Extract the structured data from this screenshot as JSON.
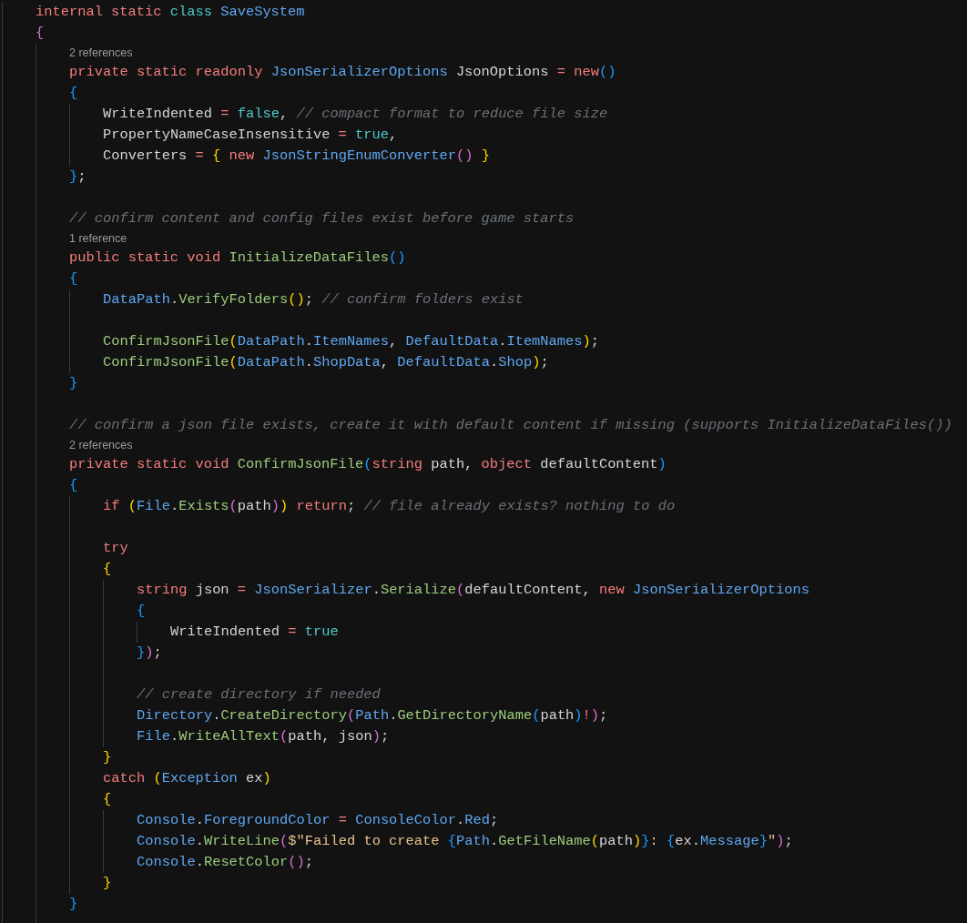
{
  "editor": {
    "lines": [
      {
        "kind": "code",
        "tokens": [
          {
            "text": "internal static ",
            "kind": "keyword"
          },
          {
            "text": "class ",
            "kind": "literal"
          },
          {
            "text": "SaveSystem",
            "kind": "type"
          }
        ]
      },
      {
        "kind": "code",
        "tokens": [
          {
            "text": "{",
            "kind": "bracket2"
          }
        ],
        "children": [
          {
            "kind": "codelens",
            "text": "2 references"
          },
          {
            "kind": "code",
            "tokens": [
              {
                "text": "private static readonly ",
                "kind": "keyword"
              },
              {
                "text": "JsonSerializerOptions",
                "kind": "type"
              },
              {
                "text": " JsonOptions ",
                "kind": "plain"
              },
              {
                "text": "= ",
                "kind": "operator"
              },
              {
                "text": "new",
                "kind": "keyword"
              },
              {
                "text": "()",
                "kind": "bracket3"
              }
            ]
          },
          {
            "kind": "code",
            "tokens": [
              {
                "text": "{",
                "kind": "bracket3"
              }
            ],
            "children": [
              {
                "kind": "code",
                "tokens": [
                  {
                    "text": "WriteIndented ",
                    "kind": "plain"
                  },
                  {
                    "text": "= ",
                    "kind": "operator"
                  },
                  {
                    "text": "false",
                    "kind": "literal"
                  },
                  {
                    "text": ", ",
                    "kind": "plain"
                  },
                  {
                    "text": "// compact format to reduce file size",
                    "kind": "comment"
                  }
                ]
              },
              {
                "kind": "code",
                "tokens": [
                  {
                    "text": "PropertyNameCaseInsensitive ",
                    "kind": "plain"
                  },
                  {
                    "text": "= ",
                    "kind": "operator"
                  },
                  {
                    "text": "true",
                    "kind": "literal"
                  },
                  {
                    "text": ",",
                    "kind": "plain"
                  }
                ]
              },
              {
                "kind": "code",
                "tokens": [
                  {
                    "text": "Converters ",
                    "kind": "plain"
                  },
                  {
                    "text": "= ",
                    "kind": "operator"
                  },
                  {
                    "text": "{ ",
                    "kind": "bracket1"
                  },
                  {
                    "text": "new ",
                    "kind": "keyword"
                  },
                  {
                    "text": "JsonStringEnumConverter",
                    "kind": "type"
                  },
                  {
                    "text": "()",
                    "kind": "bracket2"
                  },
                  {
                    "text": " }",
                    "kind": "bracket1"
                  }
                ]
              }
            ]
          },
          {
            "kind": "code",
            "tokens": [
              {
                "text": "}",
                "kind": "bracket3"
              },
              {
                "text": ";",
                "kind": "plain"
              }
            ]
          },
          {
            "kind": "blank"
          },
          {
            "kind": "code",
            "tokens": [
              {
                "text": "// confirm content and config files exist before game starts",
                "kind": "comment"
              }
            ]
          },
          {
            "kind": "codelens",
            "text": "1 reference"
          },
          {
            "kind": "code",
            "tokens": [
              {
                "text": "public static void ",
                "kind": "keyword"
              },
              {
                "text": "InitializeDataFiles",
                "kind": "method"
              },
              {
                "text": "()",
                "kind": "bracket3"
              }
            ]
          },
          {
            "kind": "code",
            "tokens": [
              {
                "text": "{",
                "kind": "bracket3"
              }
            ],
            "children": [
              {
                "kind": "code",
                "tokens": [
                  {
                    "text": "DataPath",
                    "kind": "type"
                  },
                  {
                    "text": ".",
                    "kind": "plain"
                  },
                  {
                    "text": "VerifyFolders",
                    "kind": "method"
                  },
                  {
                    "text": "()",
                    "kind": "bracket1"
                  },
                  {
                    "text": "; ",
                    "kind": "plain"
                  },
                  {
                    "text": "// confirm folders exist",
                    "kind": "comment"
                  }
                ]
              },
              {
                "kind": "blank"
              },
              {
                "kind": "code",
                "tokens": [
                  {
                    "text": "ConfirmJsonFile",
                    "kind": "method"
                  },
                  {
                    "text": "(",
                    "kind": "bracket1"
                  },
                  {
                    "text": "DataPath",
                    "kind": "type"
                  },
                  {
                    "text": ".",
                    "kind": "plain"
                  },
                  {
                    "text": "ItemNames",
                    "kind": "type"
                  },
                  {
                    "text": ", ",
                    "kind": "plain"
                  },
                  {
                    "text": "DefaultData",
                    "kind": "type"
                  },
                  {
                    "text": ".",
                    "kind": "plain"
                  },
                  {
                    "text": "ItemNames",
                    "kind": "type"
                  },
                  {
                    "text": ")",
                    "kind": "bracket1"
                  },
                  {
                    "text": ";",
                    "kind": "plain"
                  }
                ]
              },
              {
                "kind": "code",
                "tokens": [
                  {
                    "text": "ConfirmJsonFile",
                    "kind": "method"
                  },
                  {
                    "text": "(",
                    "kind": "bracket1"
                  },
                  {
                    "text": "DataPath",
                    "kind": "type"
                  },
                  {
                    "text": ".",
                    "kind": "plain"
                  },
                  {
                    "text": "ShopData",
                    "kind": "type"
                  },
                  {
                    "text": ", ",
                    "kind": "plain"
                  },
                  {
                    "text": "DefaultData",
                    "kind": "type"
                  },
                  {
                    "text": ".",
                    "kind": "plain"
                  },
                  {
                    "text": "Shop",
                    "kind": "type"
                  },
                  {
                    "text": ")",
                    "kind": "bracket1"
                  },
                  {
                    "text": ";",
                    "kind": "plain"
                  }
                ]
              }
            ]
          },
          {
            "kind": "code",
            "tokens": [
              {
                "text": "}",
                "kind": "bracket3"
              }
            ]
          },
          {
            "kind": "blank"
          },
          {
            "kind": "code",
            "tokens": [
              {
                "text": "// confirm a json file exists, create it with default content if missing (supports InitializeDataFiles())",
                "kind": "comment"
              }
            ]
          },
          {
            "kind": "codelens",
            "text": "2 references"
          },
          {
            "kind": "code",
            "tokens": [
              {
                "text": "private static void ",
                "kind": "keyword"
              },
              {
                "text": "ConfirmJsonFile",
                "kind": "method"
              },
              {
                "text": "(",
                "kind": "bracket3"
              },
              {
                "text": "string",
                "kind": "keyword"
              },
              {
                "text": " path, ",
                "kind": "plain"
              },
              {
                "text": "object",
                "kind": "keyword"
              },
              {
                "text": " defaultContent",
                "kind": "plain"
              },
              {
                "text": ")",
                "kind": "bracket3"
              }
            ]
          },
          {
            "kind": "code",
            "tokens": [
              {
                "text": "{",
                "kind": "bracket3"
              }
            ],
            "children": [
              {
                "kind": "code",
                "tokens": [
                  {
                    "text": "if ",
                    "kind": "keyword"
                  },
                  {
                    "text": "(",
                    "kind": "bracket1"
                  },
                  {
                    "text": "File",
                    "kind": "type"
                  },
                  {
                    "text": ".",
                    "kind": "plain"
                  },
                  {
                    "text": "Exists",
                    "kind": "method"
                  },
                  {
                    "text": "(",
                    "kind": "bracket2"
                  },
                  {
                    "text": "path",
                    "kind": "plain"
                  },
                  {
                    "text": ")",
                    "kind": "bracket2"
                  },
                  {
                    "text": ")",
                    "kind": "bracket1"
                  },
                  {
                    "text": " return",
                    "kind": "keyword"
                  },
                  {
                    "text": "; ",
                    "kind": "plain"
                  },
                  {
                    "text": "// file already exists? nothing to do",
                    "kind": "comment"
                  }
                ]
              },
              {
                "kind": "blank"
              },
              {
                "kind": "code",
                "tokens": [
                  {
                    "text": "try",
                    "kind": "keyword"
                  }
                ]
              },
              {
                "kind": "code",
                "tokens": [
                  {
                    "text": "{",
                    "kind": "bracket1"
                  }
                ],
                "children": [
                  {
                    "kind": "code",
                    "tokens": [
                      {
                        "text": "string",
                        "kind": "keyword"
                      },
                      {
                        "text": " json ",
                        "kind": "plain"
                      },
                      {
                        "text": "= ",
                        "kind": "operator"
                      },
                      {
                        "text": "JsonSerializer",
                        "kind": "type"
                      },
                      {
                        "text": ".",
                        "kind": "plain"
                      },
                      {
                        "text": "Serialize",
                        "kind": "method"
                      },
                      {
                        "text": "(",
                        "kind": "bracket2"
                      },
                      {
                        "text": "defaultContent, ",
                        "kind": "plain"
                      },
                      {
                        "text": "new ",
                        "kind": "keyword"
                      },
                      {
                        "text": "JsonSerializerOptions",
                        "kind": "type"
                      }
                    ]
                  },
                  {
                    "kind": "code",
                    "tokens": [
                      {
                        "text": "{",
                        "kind": "bracket3"
                      }
                    ],
                    "children": [
                      {
                        "kind": "code",
                        "tokens": [
                          {
                            "text": "WriteIndented ",
                            "kind": "plain"
                          },
                          {
                            "text": "= ",
                            "kind": "operator"
                          },
                          {
                            "text": "true",
                            "kind": "literal"
                          }
                        ]
                      }
                    ]
                  },
                  {
                    "kind": "code",
                    "tokens": [
                      {
                        "text": "}",
                        "kind": "bracket3"
                      },
                      {
                        "text": ")",
                        "kind": "bracket2"
                      },
                      {
                        "text": ";",
                        "kind": "plain"
                      }
                    ]
                  },
                  {
                    "kind": "blank"
                  },
                  {
                    "kind": "code",
                    "tokens": [
                      {
                        "text": "// create directory if needed",
                        "kind": "comment"
                      }
                    ]
                  },
                  {
                    "kind": "code",
                    "tokens": [
                      {
                        "text": "Directory",
                        "kind": "type"
                      },
                      {
                        "text": ".",
                        "kind": "plain"
                      },
                      {
                        "text": "CreateDirectory",
                        "kind": "method"
                      },
                      {
                        "text": "(",
                        "kind": "bracket2"
                      },
                      {
                        "text": "Path",
                        "kind": "type"
                      },
                      {
                        "text": ".",
                        "kind": "plain"
                      },
                      {
                        "text": "GetDirectoryName",
                        "kind": "method"
                      },
                      {
                        "text": "(",
                        "kind": "bracket3"
                      },
                      {
                        "text": "path",
                        "kind": "plain"
                      },
                      {
                        "text": ")",
                        "kind": "bracket3"
                      },
                      {
                        "text": "!",
                        "kind": "operator"
                      },
                      {
                        "text": ")",
                        "kind": "bracket2"
                      },
                      {
                        "text": ";",
                        "kind": "plain"
                      }
                    ]
                  },
                  {
                    "kind": "code",
                    "tokens": [
                      {
                        "text": "File",
                        "kind": "type"
                      },
                      {
                        "text": ".",
                        "kind": "plain"
                      },
                      {
                        "text": "WriteAllText",
                        "kind": "method"
                      },
                      {
                        "text": "(",
                        "kind": "bracket2"
                      },
                      {
                        "text": "path, json",
                        "kind": "plain"
                      },
                      {
                        "text": ")",
                        "kind": "bracket2"
                      },
                      {
                        "text": ";",
                        "kind": "plain"
                      }
                    ]
                  }
                ]
              },
              {
                "kind": "code",
                "tokens": [
                  {
                    "text": "}",
                    "kind": "bracket1"
                  }
                ]
              },
              {
                "kind": "code",
                "tokens": [
                  {
                    "text": "catch ",
                    "kind": "keyword"
                  },
                  {
                    "text": "(",
                    "kind": "bracket1"
                  },
                  {
                    "text": "Exception",
                    "kind": "type"
                  },
                  {
                    "text": " ex",
                    "kind": "plain"
                  },
                  {
                    "text": ")",
                    "kind": "bracket1"
                  }
                ]
              },
              {
                "kind": "code",
                "tokens": [
                  {
                    "text": "{",
                    "kind": "bracket1"
                  }
                ],
                "children": [
                  {
                    "kind": "code",
                    "tokens": [
                      {
                        "text": "Console",
                        "kind": "type"
                      },
                      {
                        "text": ".",
                        "kind": "plain"
                      },
                      {
                        "text": "ForegroundColor",
                        "kind": "type"
                      },
                      {
                        "text": " = ",
                        "kind": "operator"
                      },
                      {
                        "text": "ConsoleColor",
                        "kind": "type"
                      },
                      {
                        "text": ".",
                        "kind": "plain"
                      },
                      {
                        "text": "Red",
                        "kind": "type"
                      },
                      {
                        "text": ";",
                        "kind": "plain"
                      }
                    ]
                  },
                  {
                    "kind": "code",
                    "tokens": [
                      {
                        "text": "Console",
                        "kind": "type"
                      },
                      {
                        "text": ".",
                        "kind": "plain"
                      },
                      {
                        "text": "WriteLine",
                        "kind": "method"
                      },
                      {
                        "text": "(",
                        "kind": "bracket2"
                      },
                      {
                        "text": "$\"Failed to create ",
                        "kind": "string"
                      },
                      {
                        "text": "{",
                        "kind": "bracket3"
                      },
                      {
                        "text": "Path",
                        "kind": "type"
                      },
                      {
                        "text": ".",
                        "kind": "plain"
                      },
                      {
                        "text": "GetFileName",
                        "kind": "method"
                      },
                      {
                        "text": "(",
                        "kind": "bracket1"
                      },
                      {
                        "text": "path",
                        "kind": "plain"
                      },
                      {
                        "text": ")",
                        "kind": "bracket1"
                      },
                      {
                        "text": "}",
                        "kind": "bracket3"
                      },
                      {
                        "text": ": ",
                        "kind": "string"
                      },
                      {
                        "text": "{",
                        "kind": "bracket3"
                      },
                      {
                        "text": "ex",
                        "kind": "plain"
                      },
                      {
                        "text": ".",
                        "kind": "plain"
                      },
                      {
                        "text": "Message",
                        "kind": "type"
                      },
                      {
                        "text": "}",
                        "kind": "bracket3"
                      },
                      {
                        "text": "\"",
                        "kind": "string"
                      },
                      {
                        "text": ")",
                        "kind": "bracket2"
                      },
                      {
                        "text": ";",
                        "kind": "plain"
                      }
                    ]
                  },
                  {
                    "kind": "code",
                    "tokens": [
                      {
                        "text": "Console",
                        "kind": "type"
                      },
                      {
                        "text": ".",
                        "kind": "plain"
                      },
                      {
                        "text": "ResetColor",
                        "kind": "method"
                      },
                      {
                        "text": "()",
                        "kind": "bracket2"
                      },
                      {
                        "text": ";",
                        "kind": "plain"
                      }
                    ]
                  }
                ]
              },
              {
                "kind": "code",
                "tokens": [
                  {
                    "text": "}",
                    "kind": "bracket1"
                  }
                ]
              }
            ]
          },
          {
            "kind": "code",
            "tokens": [
              {
                "text": "}",
                "kind": "bracket3"
              }
            ]
          },
          {
            "kind": "blank"
          }
        ]
      }
    ]
  }
}
